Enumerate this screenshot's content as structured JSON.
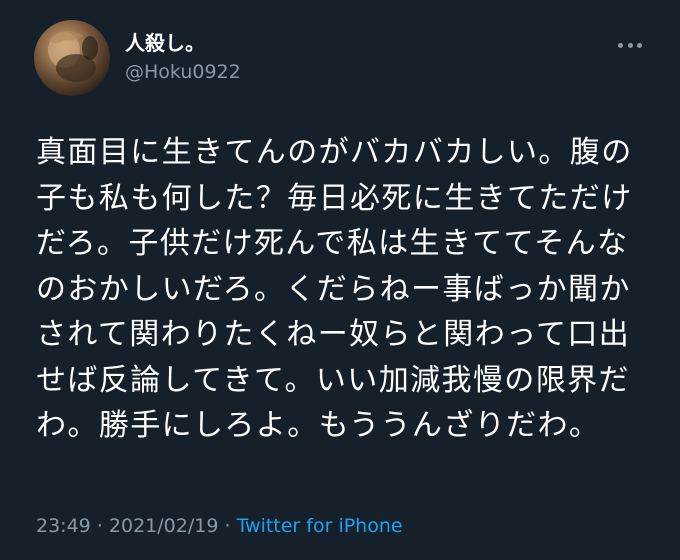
{
  "user": {
    "display_name": "人殺し。",
    "handle": "@Hoku0922",
    "avatar_icon": "avatar-photo"
  },
  "more_icon": "more-horizontal-icon",
  "tweet": {
    "lines": [
      "真面目に生きてんのがバカバカしい。腹の",
      "子も私も何した？毎日必死に生きてただけ",
      "だろ。子供だけ死んで私は生きててそんな",
      "のおかしいだろ。くだらねー事ばっか聞か",
      "されて関わりたくねー奴らと関わって口出",
      "せば反論してきて。いい加減我慢の限界だ",
      "わ。勝手にしろよ。もううんざりだわ。"
    ]
  },
  "meta": {
    "time": "23:49",
    "separator1": "·",
    "date": "2021/02/19",
    "separator2": "·",
    "source": "Twitter for iPhone"
  },
  "colors": {
    "background": "#15202b",
    "text": "#ffffff",
    "secondary": "#8899a6",
    "link": "#1da1f2"
  }
}
